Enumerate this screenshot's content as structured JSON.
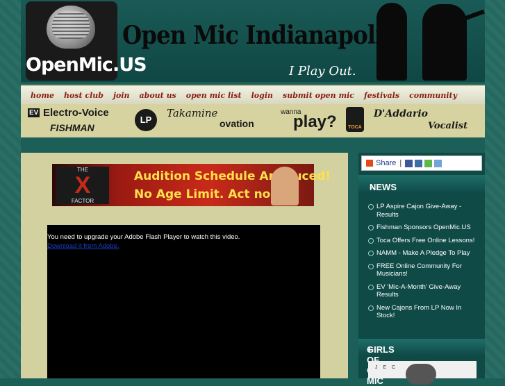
{
  "header": {
    "logo_text": "OpenMic.US",
    "site_title": "Open Mic Indianapolis",
    "tagline": "I Play Out."
  },
  "nav": {
    "items": [
      "home",
      "host club",
      "join",
      "about us",
      "open mic list",
      "login",
      "submit open mic",
      "festivals",
      "community"
    ]
  },
  "sponsors": {
    "ev": "Electro-Voice",
    "ev_badge": "EV",
    "fishman": "FISHMAN",
    "lp": "LP",
    "takamine": "Takamine",
    "ovation": "ovation",
    "wanna": "wanna",
    "play": "play?",
    "toca": "TOCA",
    "daddario": "D'Addario",
    "vocalist": "Vocalist"
  },
  "banner": {
    "logo_top": "THE",
    "logo_x": "X",
    "logo_bottom": "FACTOR",
    "line1": "Audition Schedule Annouced!",
    "line2": "No Age Limit.   Act now!"
  },
  "video": {
    "message": "You need to upgrade your Adobe Flash Player to watch this video.",
    "link": "Download it from Adobe."
  },
  "sidebar": {
    "share_label": "Share",
    "share_sep": "|",
    "news_title": "NEWS",
    "news_toggle": "-",
    "news_items": [
      "LP Aspire Cajon Give-Away - Results",
      "Fishman Sponsors OpenMic.US",
      "Toca Offers Free Online Lessons!",
      "NAMM - Make A Pledge To Play",
      "FREE Online Community For Musicians!",
      "EV 'Mic-A-Month' Give-Away Results",
      "New Cajons From LP Now In Stock!"
    ],
    "girls_title": "GIRLS OF OPEN MIC",
    "girls_toggle": "+",
    "thumb_letters": "J  E  C"
  },
  "colors": {
    "background": "#1c5e58",
    "nav_text": "#8a1f12",
    "panel": "#d4d1a0",
    "sidebar": "#0f4a47"
  }
}
